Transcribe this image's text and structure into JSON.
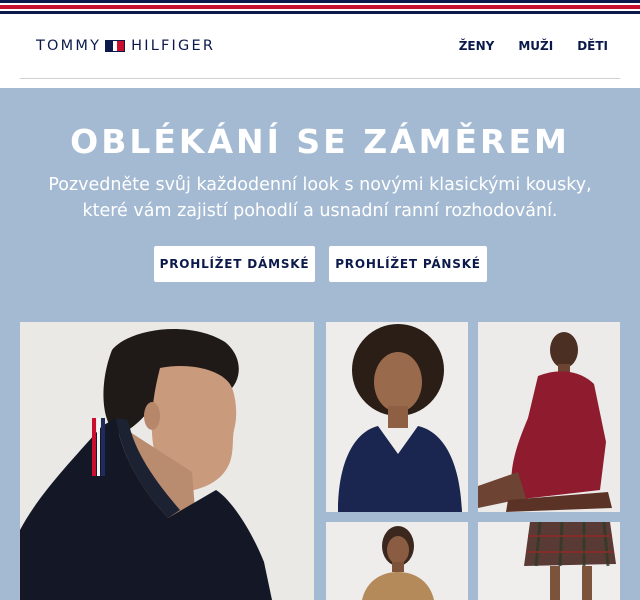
{
  "brand": {
    "name_left": "TOMMY",
    "name_right": "HILFIGER",
    "logo_icon": "flag-icon",
    "colors": {
      "navy": "#0b1a4b",
      "red": "#c8102e",
      "hero_bg": "#a4bad2"
    }
  },
  "nav": {
    "items": [
      {
        "label": "ŽENY"
      },
      {
        "label": "MUŽI"
      },
      {
        "label": "DĚTI"
      }
    ]
  },
  "hero": {
    "headline": "OBLÉKÁNÍ SE ZÁMĚREM",
    "subtitle": "Pozvedněte svůj každodenní look s novými klasickými kousky, které vám zajistí pohodlí a usnadní ranní rozhodování.",
    "buttons": {
      "women": "PROHLÍŽET DÁMSKÉ",
      "men": "PROHLÍŽET PÁNSKÉ"
    }
  }
}
